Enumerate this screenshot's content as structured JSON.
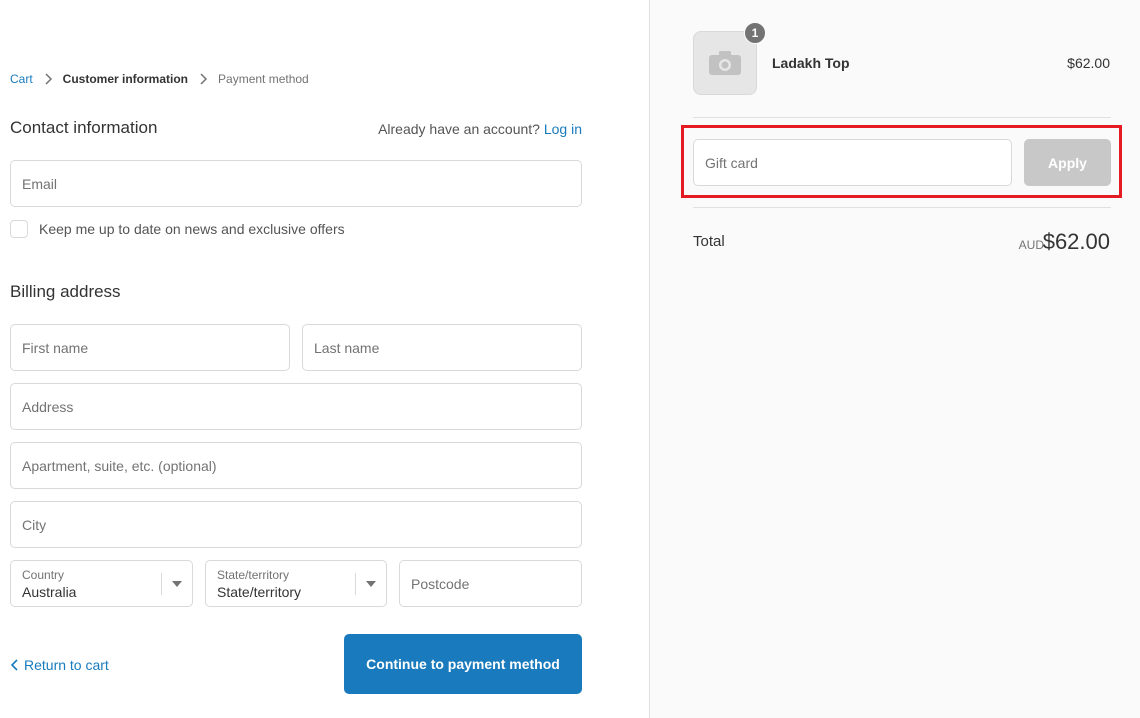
{
  "breadcrumb": {
    "items": [
      "Cart",
      "Customer information",
      "Payment method"
    ]
  },
  "contact": {
    "title": "Contact information",
    "login_prompt": "Already have an account?",
    "login_link": "Log in",
    "email_placeholder": "Email",
    "newsletter_label": "Keep me up to date on news and exclusive offers"
  },
  "billing": {
    "title": "Billing address",
    "first_name_placeholder": "First name",
    "last_name_placeholder": "Last name",
    "address_placeholder": "Address",
    "apartment_placeholder": "Apartment, suite, etc. (optional)",
    "city_placeholder": "City",
    "country_label": "Country",
    "country_value": "Australia",
    "state_label": "State/territory",
    "state_value": "State/territory",
    "postcode_placeholder": "Postcode"
  },
  "actions": {
    "return_label": "Return to cart",
    "continue_label": "Continue to payment method"
  },
  "order": {
    "product_name": "Ladakh Top",
    "product_price": "$62.00",
    "quantity": "1",
    "gift_card_placeholder": "Gift card",
    "apply_label": "Apply",
    "total_label": "Total",
    "currency": "AUD",
    "total_amount": "$62.00"
  },
  "colors": {
    "accent": "#197bbd",
    "highlight": "#e51b23",
    "apply_disabled": "#c8c8c8"
  },
  "icons": {
    "breadcrumb_separator": "chevron-right-icon",
    "select_arrow": "caret-down-icon",
    "return": "chevron-left-icon",
    "product_placeholder": "camera-icon"
  }
}
